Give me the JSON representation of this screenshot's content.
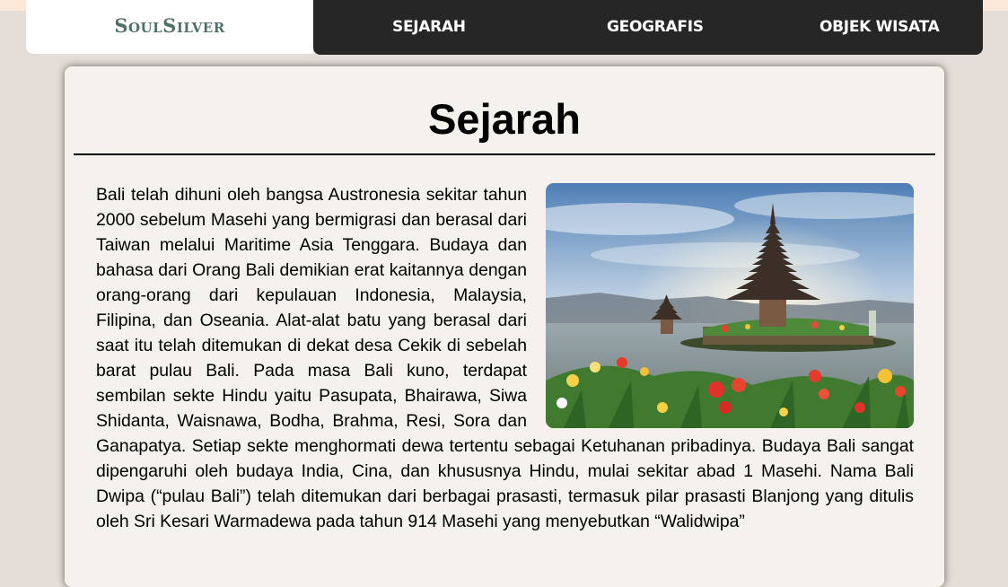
{
  "brand": {
    "logo": "SoulSilver"
  },
  "nav": {
    "items": [
      {
        "label": "SEJARAH"
      },
      {
        "label": "GEOGRAFIS"
      },
      {
        "label": "OBJEK WISATA"
      }
    ]
  },
  "section": {
    "title": "Sejarah",
    "body": "Bali telah dihuni oleh bangsa Austronesia sekitar tahun 2000 sebelum Masehi yang bermigrasi dan berasal dari Taiwan melalui Maritime Asia Tenggara. Budaya dan bahasa dari Orang Bali demikian erat kaitannya dengan orang-orang dari kepulauan Indonesia, Malaysia, Filipina, dan Oseania. Alat-alat batu yang berasal dari saat itu telah ditemukan di dekat desa Cekik di sebelah barat pulau Bali. Pada masa Bali kuno, terdapat sembilan sekte Hindu yaitu Pasupata, Bhairawa, Siwa Shidanta, Waisnawa, Bodha, Brahma, Resi, Sora dan Ganapatya. Setiap sekte menghormati dewa tertentu sebagai Ketuhanan pribadinya. Budaya Bali sangat dipengaruhi oleh budaya India, Cina, dan khususnya Hindu, mulai sekitar abad 1 Masehi. Nama Bali Dwipa (“pulau Bali”) telah ditemukan dari berbagai prasasti, termasuk pilar prasasti Blanjong yang ditulis oleh Sri Kesari Warmadewa pada tahun 914 Masehi yang menyebutkan “Walidwipa”"
  },
  "colors": {
    "navbar": "#262626",
    "logo": "#50706a",
    "card": "#f5f1ec",
    "page": "#e4ddd8"
  }
}
